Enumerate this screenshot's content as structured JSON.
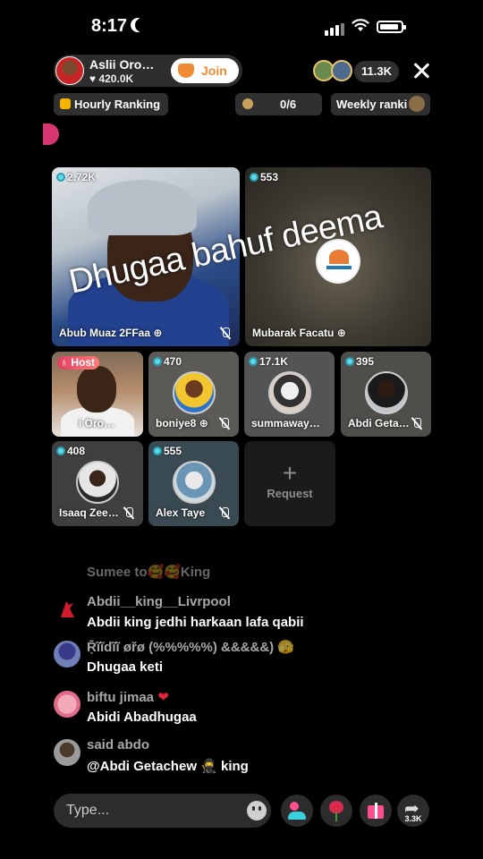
{
  "status_bar": {
    "time": "8:17"
  },
  "host": {
    "name": "Aslii Oro…",
    "likes": "♥ 420.0K",
    "join_label": "Join"
  },
  "header": {
    "viewer_count": "11.3K"
  },
  "chips": {
    "hourly": "Hourly Ranking",
    "slots": "0/6",
    "weekly": "Weekly ranki"
  },
  "tiles": [
    {
      "score": "2.72K",
      "name": "Abub Muaz 2FFaa"
    },
    {
      "score": "553",
      "name": "Mubarak Facatu"
    },
    {
      "badge": "Host",
      "name": "i Oro…"
    },
    {
      "score": "470",
      "name": "boniye8"
    },
    {
      "score": "17.1K",
      "name": "summaway…"
    },
    {
      "score": "395",
      "name": "Abdi Geta…"
    },
    {
      "score": "408",
      "name": "Isaaq Zee…"
    },
    {
      "score": "555",
      "name": "Alex Taye"
    }
  ],
  "request_tile": {
    "plus": "+",
    "label": "Request"
  },
  "overlay_text": "Dhugaa bahuf deema",
  "chat": {
    "faded_line": "Sumee to🥰🥰King",
    "messages": [
      {
        "user": "Abdii__king__Livrpool",
        "text": "Abdii king jedhi harkaan lafa qabii"
      },
      {
        "user": "Ṝĩĩdĩĩ øřø   (%%%%%) &&&&&) 🫣",
        "text": "Dhugaa keti"
      },
      {
        "user": "biftu jimaa",
        "text": "Abidi Abadhugaa"
      },
      {
        "user": "said abdo",
        "text": "@Abdi Getachew 🥷 king"
      }
    ]
  },
  "bottom": {
    "input_placeholder": "Type...",
    "share_count": "3.3K"
  },
  "colors": {
    "join": "#f08a35",
    "host_badge": "#e0405f",
    "score_dot": "#5fd8e8"
  }
}
